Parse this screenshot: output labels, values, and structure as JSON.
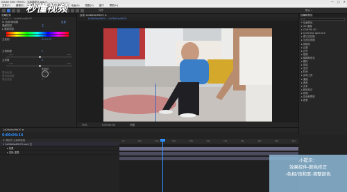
{
  "window": {
    "title": "Adobe After Effects - 无标题项目.aep *",
    "controls": [
      "—",
      "□",
      "✕"
    ]
  },
  "menu": [
    "文件(F)",
    "编辑(E)",
    "合成(C)",
    "图层(L)",
    "效果(T)",
    "动画(A)",
    "视图(V)",
    "窗口",
    "帮助(H)"
  ],
  "toolbar": {
    "snap_label": "对齐",
    "workspace_label": "默认   »"
  },
  "watermark": "秒懂视频",
  "effect_controls": {
    "tab": "效果控件",
    "layer_name": "Layer 1 · 1a08a5ad9b70",
    "reset_label": "重置",
    "rows": [
      {
        "label": "fx 色相/饱和度",
        "value": "重置"
      },
      {
        "label": "通道控制",
        "value": "主"
      },
      {
        "label": "▸ 通道范围",
        "value": ""
      },
      {
        "label": "主色相",
        "value": "0x+0.0°"
      },
      {
        "label": "主饱和度",
        "value": "0"
      },
      {
        "label": "主亮度",
        "value": "0"
      },
      {
        "label": "",
        "value": "彩色化"
      },
      {
        "label": "着色色相",
        "value": "0x+0.0°"
      },
      {
        "label": "着色饱和度",
        "value": "25"
      },
      {
        "label": "着色亮度",
        "value": "0"
      }
    ],
    "saturation_ticks": [
      "-100",
      "100"
    ],
    "lightness_ticks": [
      "-100",
      "100"
    ]
  },
  "composition": {
    "tab": "合成 1a08a5ad9b70 ≡",
    "breadcrumb": "1a08a5ad9b70 ‹ 1a08a5ad9b70",
    "zoom": "50%",
    "timecode": "0:00:00:00",
    "quality": "完整"
  },
  "effects_panel": {
    "title": "效果和预设",
    "search_placeholder": "ρ▾",
    "items": [
      "* 动画预设",
      "▸ 3D 通道",
      "▸ CINEMA 4D",
      "▸ Synthetic Aperture",
      "▸ 表达式控制",
      "▸ 沉浸式视频",
      "▸ 风格化",
      "▸ 过渡",
      "▸ 过时",
      "▸ 抠像",
      "▸ 模糊和锐化",
      "▸ 模拟",
      "▸ 扭曲",
      "▸ 生成",
      "▸ 时间",
      "▸ 实用工具",
      "▸ 通道",
      "▸ 透视",
      "▸ 文本",
      "▸ 颜色校正",
      "▸ 音频",
      "▸ 杂色和颗粒",
      "▸ 遮罩"
    ]
  },
  "timeline": {
    "tab": "1a08a5ad9b70 ≡",
    "current_time": "0:00:04:14",
    "layer_header": "# 源名称            父级和链接",
    "layers": [
      "1  1a08a5ad9b70.mp4      无",
      "▸ 效果",
      "▸ 变换           重置"
    ],
    "ruler_ticks": [
      "0s",
      "02s",
      "04s",
      "06s",
      "08s",
      "10s",
      "12s",
      "14s",
      "16s",
      "18s",
      "20s"
    ],
    "track_colors": {
      "video": "#6d6d88",
      "effect": "#4b4b5e"
    }
  },
  "tip": {
    "title": "小提示：",
    "line1": "效果控件-颜色校正",
    "line2": "-色相/饱和度-调整颜色"
  },
  "colors": {
    "accent_blue": "#2f8fff",
    "tip_bg": "#8cb9d7",
    "panel_bg": "#262626"
  }
}
